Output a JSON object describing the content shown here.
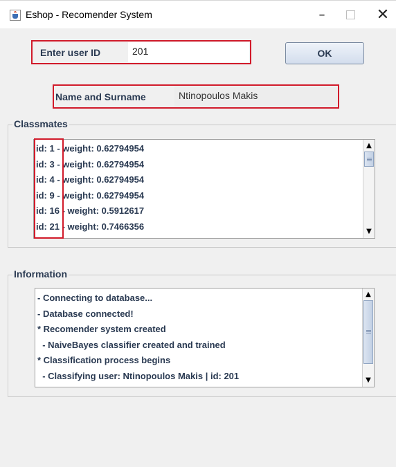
{
  "window": {
    "title": "Eshop - Recomender System",
    "app_icon": "java-cup-icon",
    "controls": {
      "minimize": "–",
      "maximize": "",
      "close": "✕"
    }
  },
  "user_id": {
    "label": "Enter user ID",
    "value": "201"
  },
  "ok_button": {
    "label": "OK"
  },
  "name": {
    "label": "Name and Surname",
    "value": "Ntinopoulos Makis"
  },
  "classmates": {
    "title": "Classmates",
    "items": [
      {
        "id": "id: 1",
        "rest": " - weight: 0.62794954"
      },
      {
        "id": "id: 3",
        "rest": " - weight: 0.62794954"
      },
      {
        "id": "id: 4",
        "rest": " - weight: 0.62794954"
      },
      {
        "id": "id: 9",
        "rest": " - weight: 0.62794954"
      },
      {
        "id": "id: 16",
        "rest": " - weight: 0.5912617"
      },
      {
        "id": "id: 21",
        "rest": " - weight: 0.7466356"
      }
    ]
  },
  "information": {
    "title": "Information",
    "lines": [
      "- Connecting to database...",
      "- Database connected!",
      "* Recomender system created",
      "  - NaiveBayes classifier created and trained",
      "* Classification process begins",
      "  - Classifying user: Ntinopoulos Makis | id: 201"
    ]
  },
  "colors": {
    "highlight_box": "#d11a2a",
    "label_text": "#2a3a52",
    "window_bg": "#f0f0f0"
  }
}
